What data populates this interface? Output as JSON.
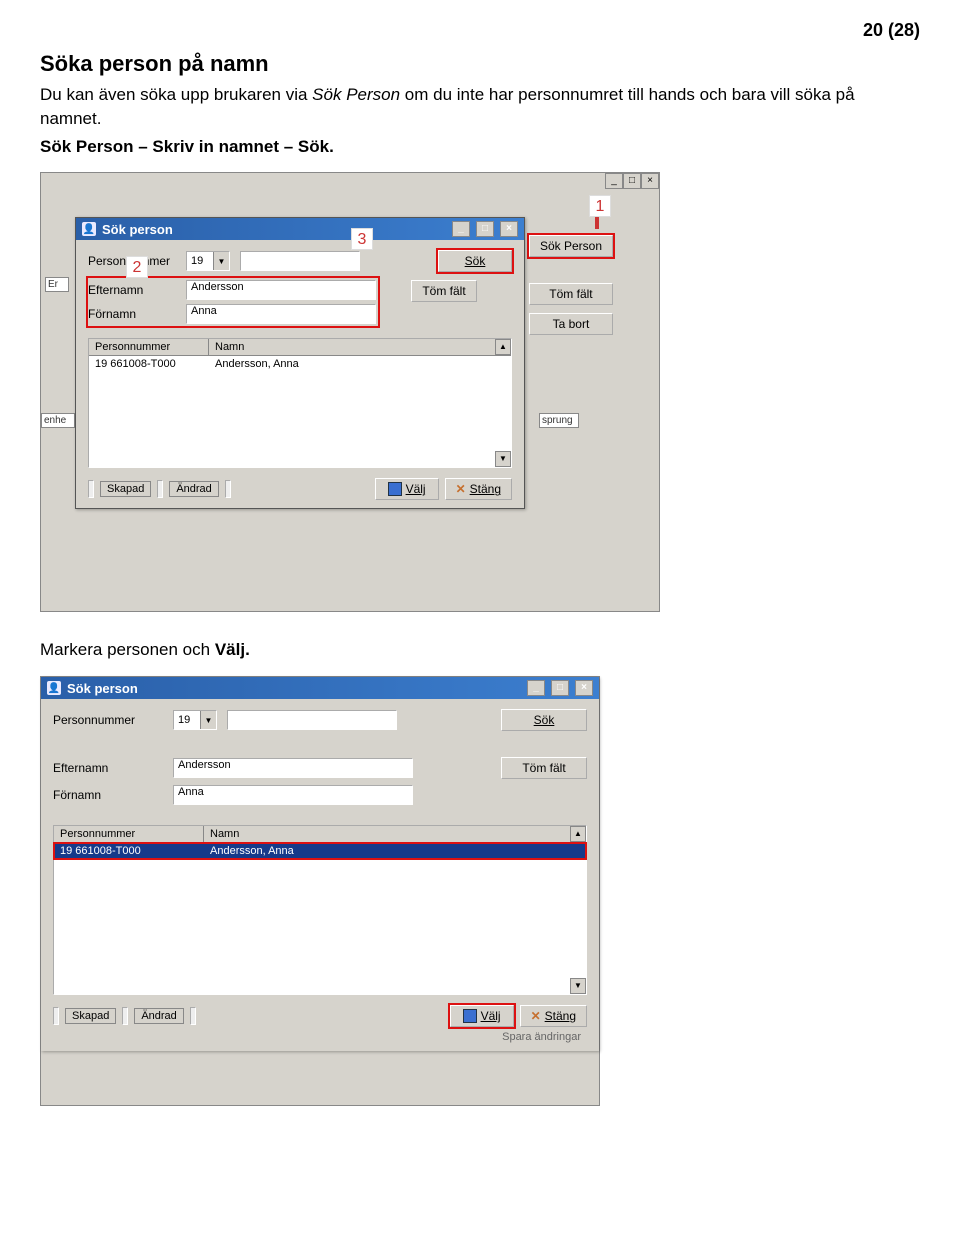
{
  "page_number": "20 (28)",
  "heading": "Söka person på namn",
  "paragraph": {
    "p1_a": "Du kan även söka upp brukaren via ",
    "p1_italic": "Sök Person",
    "p1_b": " om du inte har personnumret till hands och bara vill söka på namnet.",
    "p2_a": "Sök Person – Skriv in namnet – Sök."
  },
  "caption2": "Markera personen och Välj.",
  "dialog": {
    "title": "Sök person",
    "labels": {
      "personnummer": "Personnummer",
      "efternamn": "Efternamn",
      "fornamn": "Förnamn"
    },
    "values": {
      "century": "19",
      "pnr": "",
      "efternamn": "Andersson",
      "fornamn": "Anna"
    },
    "buttons": {
      "sok": "Sök",
      "tom_falt": "Töm fält",
      "ta_bort": "Ta bort",
      "sok_person": "Sök Person",
      "valj": "Välj",
      "stang": "Stäng",
      "skapad": "Skapad",
      "andrad": "Ändrad",
      "spara": "Spara ändringar"
    },
    "table": {
      "headers": {
        "pnr": "Personnummer",
        "namn": "Namn"
      },
      "row": {
        "pnr": "19 661008-T000",
        "namn": "Andersson, Anna"
      }
    }
  },
  "annotations": {
    "n1": "1",
    "n2": "2",
    "n3": "3"
  },
  "bg": {
    "enhe": "enhe",
    "er": "Er",
    "sprung": "sprung"
  },
  "win": {
    "min": "_",
    "max": "□",
    "close": "×"
  }
}
